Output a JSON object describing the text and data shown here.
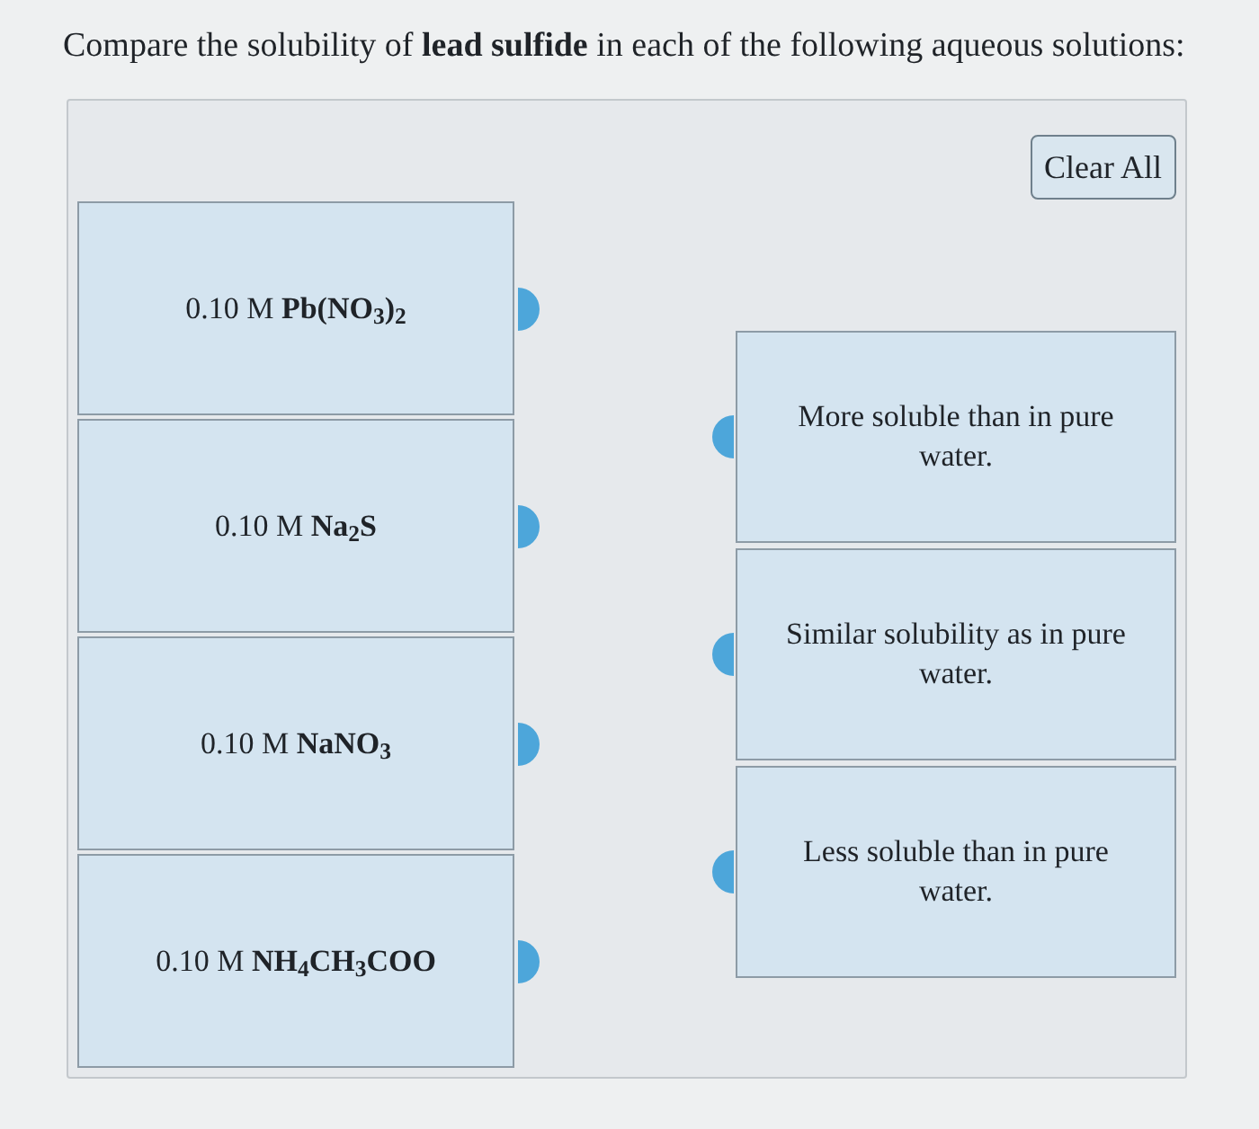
{
  "question": {
    "text": "Compare the solubility of **lead sulfide** in each of the following aqueous solutions:"
  },
  "clear_button": {
    "label": "Clear All"
  },
  "solutions": [
    {
      "label": "0.10 M **Pb(NO$_{3}$)$_{2}$**"
    },
    {
      "label": "0.10 M **Na$_{2}$S**"
    },
    {
      "label": "0.10 M **NaNO$_{3}$**"
    },
    {
      "label": "0.10 M **NH$_{4}$CH$_{3}$COO**"
    }
  ],
  "answers": [
    {
      "label": "More soluble than in pure water."
    },
    {
      "label": "Similar solubility as in pure water."
    },
    {
      "label": "Less soluble than in pure water."
    }
  ]
}
